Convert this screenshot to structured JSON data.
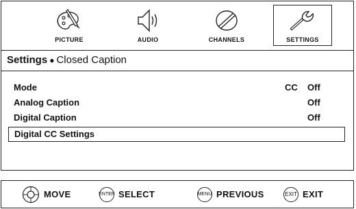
{
  "tabs": [
    {
      "label": "PICTURE",
      "icon": "palette-icon"
    },
    {
      "label": "AUDIO",
      "icon": "speaker-icon"
    },
    {
      "label": "CHANNELS",
      "icon": "satellite-dish-icon"
    },
    {
      "label": "SETTINGS",
      "icon": "wrench-icon",
      "selected": true
    }
  ],
  "breadcrumb": {
    "section": "Settings",
    "separator": "●",
    "page": "Closed Caption"
  },
  "menu": [
    {
      "label": "Mode",
      "prefix": "CC",
      "value": "Off"
    },
    {
      "label": "Analog Caption",
      "value": "Off"
    },
    {
      "label": "Digital Caption",
      "value": "Off"
    },
    {
      "label": "Digital CC Settings",
      "value": "",
      "highlighted": true
    }
  ],
  "footer": {
    "move": {
      "label": "MOVE",
      "icon": "dpad-icon"
    },
    "select": {
      "key": "ENTER",
      "label": "SELECT"
    },
    "previous": {
      "key": "MENU",
      "label": "PREVIOUS"
    },
    "exit": {
      "key": "EXIT",
      "label": "EXIT"
    }
  }
}
